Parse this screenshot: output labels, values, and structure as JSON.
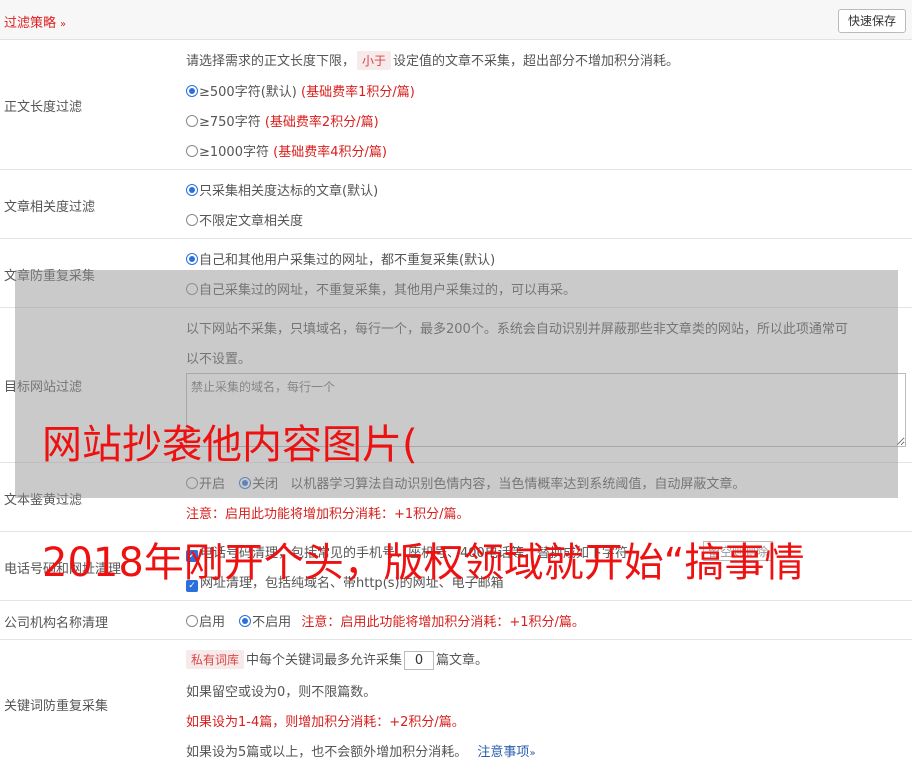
{
  "header": {
    "title": "过滤策略",
    "chevron": "»",
    "save_label": "快速保存"
  },
  "length_filter": {
    "label": "正文长度过滤",
    "desc_pre": "请选择需求的正文长度下限，",
    "desc_kw": "小于",
    "desc_post": "设定值的文章不采集，超出部分不增加积分消耗。",
    "options": [
      {
        "text": "≥500字符(默认)",
        "fee": "(基础费率1积分/篇)",
        "selected": true
      },
      {
        "text": "≥750字符",
        "fee": "(基础费率2积分/篇)",
        "selected": false
      },
      {
        "text": "≥1000字符",
        "fee": "(基础费率4积分/篇)",
        "selected": false
      }
    ]
  },
  "relevance_filter": {
    "label": "文章相关度过滤",
    "options": [
      {
        "text": "只采集相关度达标的文章(默认)",
        "selected": true
      },
      {
        "text": "不限定文章相关度",
        "selected": false
      }
    ]
  },
  "duplicate_filter": {
    "label": "文章防重复采集",
    "options": [
      {
        "text": "自己和其他用户采集过的网址，都不重复采集(默认)",
        "selected": true
      },
      {
        "text": "自己采集过的网址，不重复采集，其他用户采集过的，可以再采。",
        "selected": false
      }
    ]
  },
  "site_filter": {
    "label": "目标网站过滤",
    "desc1": "以下网站不采集，只填域名，每行一个，最多200个。系统会自动识别并屏蔽那些非文章类的网站，所以此项通常可",
    "desc2": "以不设置。",
    "placeholder": "禁止采集的域名，每行一个"
  },
  "porn_filter": {
    "label": "文本鉴黄过滤",
    "on": "开启",
    "off": "关闭",
    "off_selected": true,
    "desc": "以机器学习算法自动识别色情内容，当色情概率达到系统阈值，自动屏蔽文章。",
    "note": "注意：启用此功能将增加积分消耗：+1积分/篇。"
  },
  "phone_filter": {
    "label": "电话号码和网址清理",
    "line1_prefix": "电话号码清理，包括常见的手机号、座机号、400电话等，",
    "line1_suffix": "替换成如下字符",
    "replace_placeholder": "留空则删除",
    "line2": "网址清理，包括纯域名、带http(s)的网址、电子邮箱"
  },
  "org_filter": {
    "label": "公司机构名称清理",
    "on": "启用",
    "off": "不启用",
    "off_selected": true,
    "note": "注意：启用此功能将增加积分消耗：+1积分/篇。"
  },
  "keyword_filter": {
    "label": "关键词防重复采集",
    "kw": "私有词库",
    "line1_pre": "中每个关键词最多允许采集",
    "value": "0",
    "line1_post": "篇文章。",
    "line2": "如果留空或设为0，则不限篇数。",
    "line3": "如果设为1-4篇，则增加积分消耗：+2积分/篇。",
    "line4": "如果设为5篇或以上，也不会额外增加积分消耗。",
    "link": "注意事项",
    "link_chevron": "»"
  },
  "watermark": {
    "line1": "网站抄袭他内容图片(",
    "line2": "2018年刚开个头，版权领域就开始“搞事情"
  }
}
